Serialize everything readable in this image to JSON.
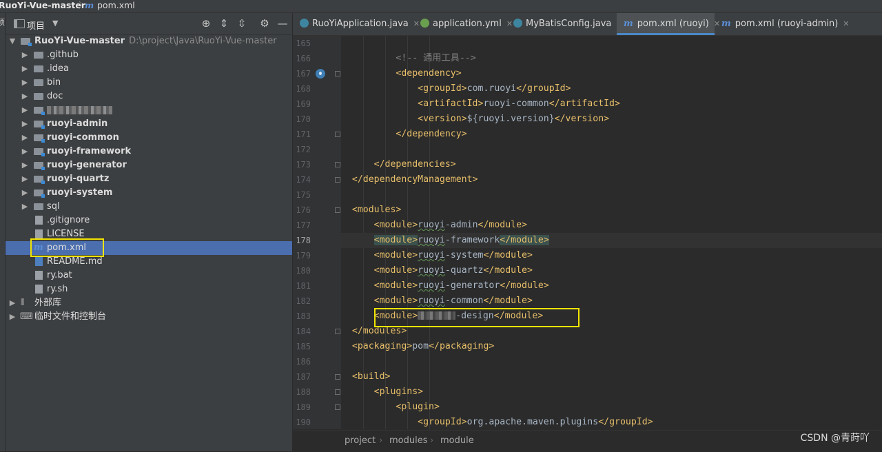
{
  "topbar": {
    "project": "RuoYi-Vue-master",
    "file": "pom.xml"
  },
  "side_strip_label": "项",
  "project_panel": {
    "title": "项目",
    "root": {
      "name": "RuoYi-Vue-master",
      "path": "D:\\project\\Java\\RuoYi-Vue-master"
    },
    "items": [
      {
        "label": ".github",
        "kind": "folder"
      },
      {
        "label": ".idea",
        "kind": "folder"
      },
      {
        "label": "bin",
        "kind": "folder"
      },
      {
        "label": "doc",
        "kind": "folder"
      },
      {
        "label": "",
        "kind": "module-blurred"
      },
      {
        "label": "ruoyi-admin",
        "kind": "module"
      },
      {
        "label": "ruoyi-common",
        "kind": "module"
      },
      {
        "label": "ruoyi-framework",
        "kind": "module"
      },
      {
        "label": "ruoyi-generator",
        "kind": "module"
      },
      {
        "label": "ruoyi-quartz",
        "kind": "module"
      },
      {
        "label": "ruoyi-system",
        "kind": "module"
      },
      {
        "label": "sql",
        "kind": "folder"
      },
      {
        "label": ".gitignore",
        "kind": "file"
      },
      {
        "label": "LICENSE",
        "kind": "file"
      },
      {
        "label": "pom.xml",
        "kind": "maven",
        "selected": true
      },
      {
        "label": "README.md",
        "kind": "md"
      },
      {
        "label": "ry.bat",
        "kind": "file"
      },
      {
        "label": "ry.sh",
        "kind": "file"
      }
    ],
    "external": "外部库",
    "scratches": "临时文件和控制台"
  },
  "tabs": [
    {
      "label": "RuoYiApplication.java",
      "icon": "java-class-icon"
    },
    {
      "label": "application.yml",
      "icon": "spring-leaf-icon"
    },
    {
      "label": "MyBatisConfig.java",
      "icon": "java-class-icon"
    },
    {
      "label": "pom.xml (ruoyi)",
      "icon": "maven-icon",
      "active": true
    },
    {
      "label": "pom.xml (ruoyi-admin)",
      "icon": "maven-icon"
    }
  ],
  "code": {
    "lines": [
      {
        "n": "165",
        "html": ""
      },
      {
        "n": "166",
        "html": "        <span class='cm'>&lt;!-- 通用工具--&gt;</span>"
      },
      {
        "n": "167",
        "html": "        <span class='tg'>&lt;dependency&gt;</span>"
      },
      {
        "n": "168",
        "html": "            <span class='tg'>&lt;groupId&gt;</span>com.ruoyi<span class='tg'>&lt;/groupId&gt;</span>"
      },
      {
        "n": "169",
        "html": "            <span class='tg'>&lt;artifactId&gt;</span>ruoyi-common<span class='tg'>&lt;/artifactId&gt;</span>"
      },
      {
        "n": "170",
        "html": "            <span class='tg'>&lt;version&gt;</span>${ruoyi.version}<span class='tg'>&lt;/version&gt;</span>"
      },
      {
        "n": "171",
        "html": "        <span class='tg'>&lt;/dependency&gt;</span>"
      },
      {
        "n": "172",
        "html": ""
      },
      {
        "n": "173",
        "html": "    <span class='tg'>&lt;/dependencies&gt;</span>"
      },
      {
        "n": "174",
        "html": "<span class='tg'>&lt;/dependencyManagement&gt;</span>"
      },
      {
        "n": "175",
        "html": ""
      },
      {
        "n": "176",
        "html": "<span class='tg'>&lt;modules&gt;</span>"
      },
      {
        "n": "177",
        "html": "    <span class='tg'>&lt;module&gt;</span><span class='wavy'>ruoyi</span>-admin<span class='tg'>&lt;/module&gt;</span>"
      },
      {
        "n": "178",
        "html": "    <span class='tg hl'>&lt;module&gt;</span><span class='wavy'>ruoyi</span>-framework<span class='tg hl'>&lt;/module&gt;</span>",
        "current": true
      },
      {
        "n": "179",
        "html": "    <span class='tg'>&lt;module&gt;</span><span class='wavy'>ruoyi</span>-system<span class='tg'>&lt;/module&gt;</span>"
      },
      {
        "n": "180",
        "html": "    <span class='tg'>&lt;module&gt;</span><span class='wavy'>ruoyi</span>-quartz<span class='tg'>&lt;/module&gt;</span>"
      },
      {
        "n": "181",
        "html": "    <span class='tg'>&lt;module&gt;</span><span class='wavy'>ruoyi</span>-generator<span class='tg'>&lt;/module&gt;</span>"
      },
      {
        "n": "182",
        "html": "    <span class='tg'>&lt;module&gt;</span><span class='wavy'>ruoyi</span>-common<span class='tg'>&lt;/module&gt;</span>"
      },
      {
        "n": "183",
        "html": "    <span class='tg'>&lt;module&gt;</span><span class='blur2'></span>-design<span class='tg'>&lt;/module&gt;</span>"
      },
      {
        "n": "184",
        "html": "<span class='tg'>&lt;/modules&gt;</span>"
      },
      {
        "n": "185",
        "html": "<span class='tg'>&lt;packaging&gt;</span>pom<span class='tg'>&lt;/packaging&gt;</span>"
      },
      {
        "n": "186",
        "html": ""
      },
      {
        "n": "187",
        "html": "<span class='tg'>&lt;build&gt;</span>"
      },
      {
        "n": "188",
        "html": "    <span class='tg'>&lt;plugins&gt;</span>"
      },
      {
        "n": "189",
        "html": "        <span class='tg'>&lt;plugin&gt;</span>"
      },
      {
        "n": "190",
        "html": "            <span class='tg'>&lt;groupId&gt;</span>org.apache.maven.plugins<span class='tg'>&lt;/groupId&gt;</span>"
      }
    ]
  },
  "breadcrumb": [
    "project",
    "modules",
    "module"
  ],
  "watermark": "CSDN @青莳吖"
}
